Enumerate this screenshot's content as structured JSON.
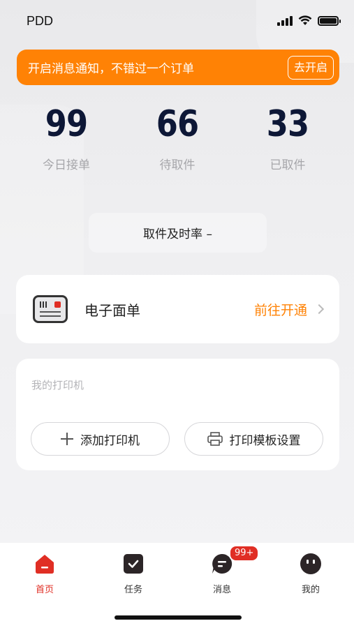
{
  "status_bar": {
    "carrier": "PDD"
  },
  "banner": {
    "text": "开启消息通知，不错过一个订单",
    "button": "去开启"
  },
  "stats": [
    {
      "value": "99",
      "label": "今日接单"
    },
    {
      "value": "66",
      "label": "待取件"
    },
    {
      "value": "33",
      "label": "已取件"
    }
  ],
  "pickup_rate": {
    "label": "取件及时率 –"
  },
  "ewaybill": {
    "title": "电子面单",
    "action": "前往开通"
  },
  "printer": {
    "section_title": "我的打印机",
    "add_button": "添加打印机",
    "template_button": "打印模板设置"
  },
  "tabs": [
    {
      "label": "首页",
      "icon": "home-icon",
      "active": true
    },
    {
      "label": "任务",
      "icon": "task-icon",
      "active": false
    },
    {
      "label": "消息",
      "icon": "message-icon",
      "active": false
    },
    {
      "label": "我的",
      "icon": "profile-icon",
      "active": false
    }
  ],
  "message_badge": "99+",
  "colors": {
    "accent": "#ff8205",
    "brand_red": "#e02e24",
    "stat_number": "#0d1736"
  }
}
